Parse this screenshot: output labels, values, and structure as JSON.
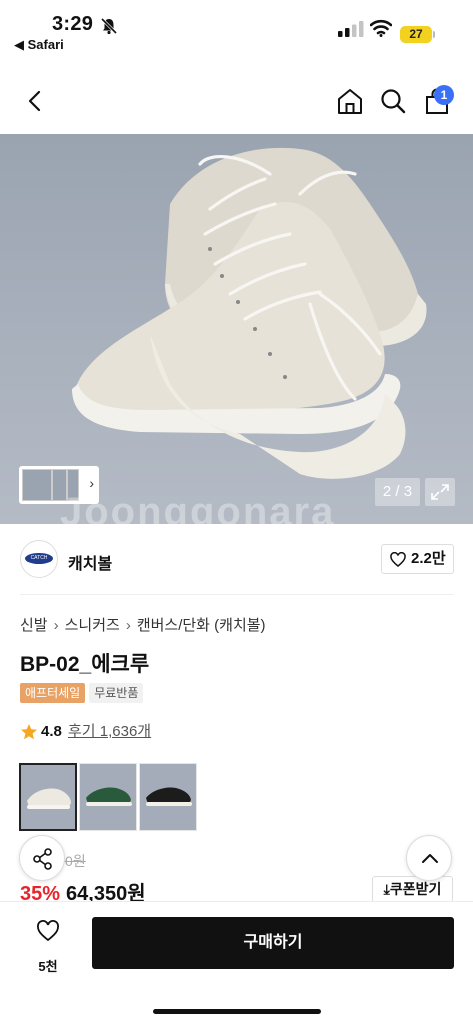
{
  "status_bar": {
    "time": "3:29",
    "back_app": "◀ Safari",
    "battery": "27",
    "battery_color": "#f3d21f"
  },
  "nav": {
    "icons": [
      "back-arrow-icon",
      "home-icon",
      "search-icon",
      "shopping-bag-icon"
    ],
    "cart_count": "1",
    "badge_color": "#3b6ff5"
  },
  "gallery": {
    "counter": "2 / 3",
    "watermark": "Joonggonara"
  },
  "seller": {
    "name": "캐치볼",
    "logo_text": "CATCH BALL",
    "likes": "2.2만"
  },
  "product": {
    "breadcrumb": [
      "신발",
      "스니커즈",
      "캔버스/단화 (캐치볼)"
    ],
    "title": "BP-02_에크루",
    "tags": [
      "애프터세일",
      "무료반품"
    ],
    "rating": "4.8",
    "reviews": "후기 1,636개",
    "color_options": [
      "ecru",
      "green",
      "black"
    ],
    "original_price": "99,000원",
    "discount": "35%",
    "price": "64,350원",
    "coupon_label": "쿠폰받기",
    "accent_red": "#e8232a"
  },
  "bottom_bar": {
    "wish_count": "5천",
    "buy_label": "구매하기"
  }
}
